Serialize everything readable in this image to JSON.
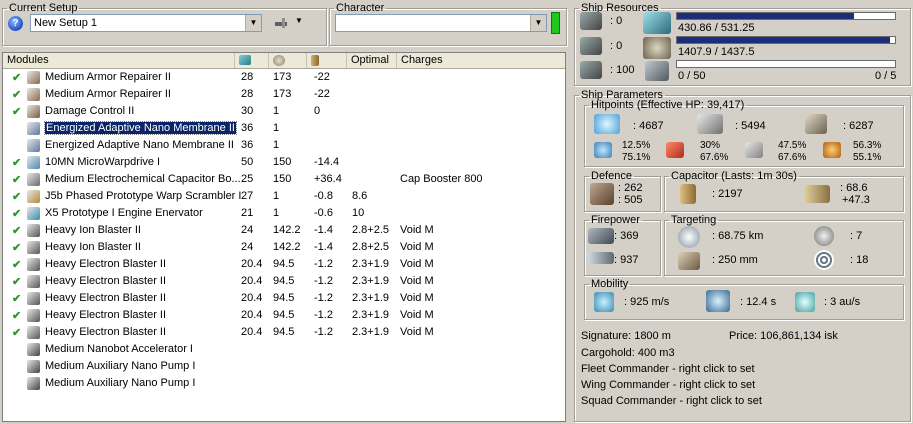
{
  "setup": {
    "label": "Current Setup",
    "value": "New Setup 1"
  },
  "character": {
    "label": "Character",
    "value": ""
  },
  "modules": {
    "headers": [
      "Modules",
      "",
      "",
      "",
      "Optimal",
      "Charges"
    ],
    "header_icons": [
      "cpu-icon",
      "powergrid-icon",
      "capacitor-icon"
    ],
    "rows": [
      {
        "active": true,
        "name": "Medium Armor Repairer II",
        "cpu": "28",
        "pg": "173",
        "cap": "-22",
        "optimal": "",
        "charges": "",
        "icon_color": "#8a6a4a"
      },
      {
        "active": true,
        "name": "Medium Armor Repairer II",
        "cpu": "28",
        "pg": "173",
        "cap": "-22",
        "optimal": "",
        "charges": "",
        "icon_color": "#8a6a4a"
      },
      {
        "active": true,
        "name": "Damage Control II",
        "cpu": "30",
        "pg": "1",
        "cap": "0",
        "optimal": "",
        "charges": "",
        "icon_color": "#7a5a3a"
      },
      {
        "active": false,
        "name": "Energized Adaptive Nano Membrane II",
        "cpu": "36",
        "pg": "1",
        "cap": "",
        "optimal": "",
        "charges": "",
        "icon_color": "#5a7aa0",
        "selected": true
      },
      {
        "active": false,
        "name": "Energized Adaptive Nano Membrane II",
        "cpu": "36",
        "pg": "1",
        "cap": "",
        "optimal": "",
        "charges": "",
        "icon_color": "#5a7aa0"
      },
      {
        "active": true,
        "name": "10MN MicroWarpdrive I",
        "cpu": "50",
        "pg": "150",
        "cap": "-14.4",
        "optimal": "",
        "charges": "",
        "icon_color": "#4a8ab0"
      },
      {
        "active": true,
        "name": "Medium Electrochemical Capacitor Bo...",
        "cpu": "25",
        "pg": "150",
        "cap": "+36.4",
        "optimal": "",
        "charges": "Cap Booster 800",
        "icon_color": "#6a6a6a"
      },
      {
        "active": true,
        "name": "J5b Phased Prototype Warp Scrambler I",
        "cpu": "27",
        "pg": "1",
        "cap": "-0.8",
        "optimal": "8.6",
        "charges": "",
        "icon_color": "#b08a3a"
      },
      {
        "active": true,
        "name": "X5 Prototype I Engine Enervator",
        "cpu": "21",
        "pg": "1",
        "cap": "-0.6",
        "optimal": "10",
        "charges": "",
        "icon_color": "#3a8ab0"
      },
      {
        "active": true,
        "name": "Heavy Ion Blaster II",
        "cpu": "24",
        "pg": "142.2",
        "cap": "-1.4",
        "optimal": "2.8+2.5",
        "charges": "Void M",
        "icon_color": "#555555"
      },
      {
        "active": true,
        "name": "Heavy Ion Blaster II",
        "cpu": "24",
        "pg": "142.2",
        "cap": "-1.4",
        "optimal": "2.8+2.5",
        "charges": "Void M",
        "icon_color": "#555555"
      },
      {
        "active": true,
        "name": "Heavy Electron Blaster II",
        "cpu": "20.4",
        "pg": "94.5",
        "cap": "-1.2",
        "optimal": "2.3+1.9",
        "charges": "Void M",
        "icon_color": "#555555"
      },
      {
        "active": true,
        "name": "Heavy Electron Blaster II",
        "cpu": "20.4",
        "pg": "94.5",
        "cap": "-1.2",
        "optimal": "2.3+1.9",
        "charges": "Void M",
        "icon_color": "#555555"
      },
      {
        "active": true,
        "name": "Heavy Electron Blaster II",
        "cpu": "20.4",
        "pg": "94.5",
        "cap": "-1.2",
        "optimal": "2.3+1.9",
        "charges": "Void M",
        "icon_color": "#555555"
      },
      {
        "active": true,
        "name": "Heavy Electron Blaster II",
        "cpu": "20.4",
        "pg": "94.5",
        "cap": "-1.2",
        "optimal": "2.3+1.9",
        "charges": "Void M",
        "icon_color": "#555555"
      },
      {
        "active": true,
        "name": "Heavy Electron Blaster II",
        "cpu": "20.4",
        "pg": "94.5",
        "cap": "-1.2",
        "optimal": "2.3+1.9",
        "charges": "Void M",
        "icon_color": "#555555"
      },
      {
        "active": false,
        "name": "Medium Nanobot Accelerator I",
        "cpu": "",
        "pg": "",
        "cap": "",
        "optimal": "",
        "charges": "",
        "icon_color": "#444444"
      },
      {
        "active": false,
        "name": "Medium Auxiliary Nano Pump I",
        "cpu": "",
        "pg": "",
        "cap": "",
        "optimal": "",
        "charges": "",
        "icon_color": "#444444"
      },
      {
        "active": false,
        "name": "Medium Auxiliary Nano Pump I",
        "cpu": "",
        "pg": "",
        "cap": "",
        "optimal": "",
        "charges": "",
        "icon_color": "#444444"
      }
    ]
  },
  "resources": {
    "label": "Ship Resources",
    "turret_slots": ": 0",
    "launcher_slots": ": 0",
    "drone_bay": ": 100",
    "cpu_text": "430.86 / 531.25",
    "cpu_fraction": 0.811,
    "pg_text": "1407.9 / 1437.5",
    "pg_fraction": 0.979,
    "drones_text": "0 / 50",
    "drones_fraction": 0,
    "drones_active": "0 / 5"
  },
  "params": {
    "label": "Ship Parameters",
    "hitpoints_label": "Hitpoints (Effective HP: 39,417)",
    "shield_hp": ": 4687",
    "armor_hp": ": 5494",
    "structure_hp": ": 6287",
    "resist_em": [
      "12.5%",
      "75.1%"
    ],
    "resist_thermal": [
      "30%",
      "67.6%"
    ],
    "resist_kinetic": [
      "47.5%",
      "67.6%"
    ],
    "resist_explosive": [
      "56.3%",
      "55.1%"
    ],
    "defence_label": "Defence",
    "defence_values": [
      ": 262",
      ": 505"
    ],
    "capacitor_label": "Capacitor (Lasts: 1m 30s)",
    "capacitor_amount": ": 2197",
    "capacitor_rates": [
      ": 68.6",
      "+47.3"
    ],
    "firepower_label": "Firepower",
    "firepower_values": [
      ": 369",
      ": 937"
    ],
    "targeting_label": "Targeting",
    "targeting_range": ": 68.75 km",
    "targeting_scan": ": 250 mm",
    "targeting_max": ": 7",
    "targeting_sensor": ": 18",
    "mobility_label": "Mobility",
    "speed": ": 925 m/s",
    "align": ": 12.4 s",
    "warp": ": 3 au/s",
    "signature": "Signature: 1800 m",
    "price": "Price: 106,861,134 isk",
    "cargo": "Cargohold: 400 m3",
    "fleet_cmd": "Fleet Commander - right click to set",
    "wing_cmd": "Wing Commander - right click to set",
    "squad_cmd": "Squad Commander - right click to set"
  }
}
